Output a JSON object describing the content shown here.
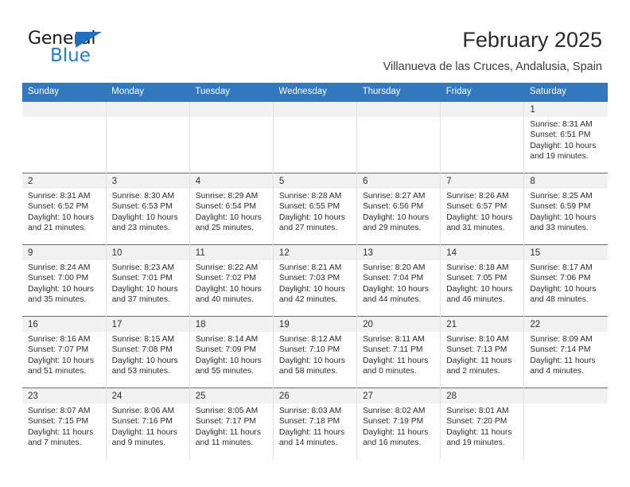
{
  "brand": {
    "name_part1": "General",
    "name_part2": "Blue",
    "triangle_color": "#1f6fc4",
    "blue_color": "#1f7fd0"
  },
  "header": {
    "title": "February 2025",
    "subtitle": "Villanueva de las Cruces, Andalusia, Spain"
  },
  "theme": {
    "header_blue": "#3178be",
    "band_gray": "#f1f1f1",
    "grid_line": "#e2e2e2"
  },
  "weekdays": [
    "Sunday",
    "Monday",
    "Tuesday",
    "Wednesday",
    "Thursday",
    "Friday",
    "Saturday"
  ],
  "labels": {
    "sunrise": "Sunrise:",
    "sunset": "Sunset:",
    "daylight": "Daylight:"
  },
  "weeks": [
    [
      {
        "day": "",
        "sunrise": "",
        "sunset": "",
        "daylight_line1": "",
        "daylight_line2": "",
        "empty": true
      },
      {
        "day": "",
        "sunrise": "",
        "sunset": "",
        "daylight_line1": "",
        "daylight_line2": "",
        "empty": true
      },
      {
        "day": "",
        "sunrise": "",
        "sunset": "",
        "daylight_line1": "",
        "daylight_line2": "",
        "empty": true
      },
      {
        "day": "",
        "sunrise": "",
        "sunset": "",
        "daylight_line1": "",
        "daylight_line2": "",
        "empty": true
      },
      {
        "day": "",
        "sunrise": "",
        "sunset": "",
        "daylight_line1": "",
        "daylight_line2": "",
        "empty": true
      },
      {
        "day": "",
        "sunrise": "",
        "sunset": "",
        "daylight_line1": "",
        "daylight_line2": "",
        "empty": true
      },
      {
        "day": "1",
        "sunrise": "Sunrise: 8:31 AM",
        "sunset": "Sunset: 6:51 PM",
        "daylight_line1": "Daylight: 10 hours",
        "daylight_line2": "and 19 minutes.",
        "empty": false
      }
    ],
    [
      {
        "day": "2",
        "sunrise": "Sunrise: 8:31 AM",
        "sunset": "Sunset: 6:52 PM",
        "daylight_line1": "Daylight: 10 hours",
        "daylight_line2": "and 21 minutes.",
        "empty": false
      },
      {
        "day": "3",
        "sunrise": "Sunrise: 8:30 AM",
        "sunset": "Sunset: 6:53 PM",
        "daylight_line1": "Daylight: 10 hours",
        "daylight_line2": "and 23 minutes.",
        "empty": false
      },
      {
        "day": "4",
        "sunrise": "Sunrise: 8:29 AM",
        "sunset": "Sunset: 6:54 PM",
        "daylight_line1": "Daylight: 10 hours",
        "daylight_line2": "and 25 minutes.",
        "empty": false
      },
      {
        "day": "5",
        "sunrise": "Sunrise: 8:28 AM",
        "sunset": "Sunset: 6:55 PM",
        "daylight_line1": "Daylight: 10 hours",
        "daylight_line2": "and 27 minutes.",
        "empty": false
      },
      {
        "day": "6",
        "sunrise": "Sunrise: 8:27 AM",
        "sunset": "Sunset: 6:56 PM",
        "daylight_line1": "Daylight: 10 hours",
        "daylight_line2": "and 29 minutes.",
        "empty": false
      },
      {
        "day": "7",
        "sunrise": "Sunrise: 8:26 AM",
        "sunset": "Sunset: 6:57 PM",
        "daylight_line1": "Daylight: 10 hours",
        "daylight_line2": "and 31 minutes.",
        "empty": false
      },
      {
        "day": "8",
        "sunrise": "Sunrise: 8:25 AM",
        "sunset": "Sunset: 6:59 PM",
        "daylight_line1": "Daylight: 10 hours",
        "daylight_line2": "and 33 minutes.",
        "empty": false
      }
    ],
    [
      {
        "day": "9",
        "sunrise": "Sunrise: 8:24 AM",
        "sunset": "Sunset: 7:00 PM",
        "daylight_line1": "Daylight: 10 hours",
        "daylight_line2": "and 35 minutes.",
        "empty": false
      },
      {
        "day": "10",
        "sunrise": "Sunrise: 8:23 AM",
        "sunset": "Sunset: 7:01 PM",
        "daylight_line1": "Daylight: 10 hours",
        "daylight_line2": "and 37 minutes.",
        "empty": false
      },
      {
        "day": "11",
        "sunrise": "Sunrise: 8:22 AM",
        "sunset": "Sunset: 7:02 PM",
        "daylight_line1": "Daylight: 10 hours",
        "daylight_line2": "and 40 minutes.",
        "empty": false
      },
      {
        "day": "12",
        "sunrise": "Sunrise: 8:21 AM",
        "sunset": "Sunset: 7:03 PM",
        "daylight_line1": "Daylight: 10 hours",
        "daylight_line2": "and 42 minutes.",
        "empty": false
      },
      {
        "day": "13",
        "sunrise": "Sunrise: 8:20 AM",
        "sunset": "Sunset: 7:04 PM",
        "daylight_line1": "Daylight: 10 hours",
        "daylight_line2": "and 44 minutes.",
        "empty": false
      },
      {
        "day": "14",
        "sunrise": "Sunrise: 8:18 AM",
        "sunset": "Sunset: 7:05 PM",
        "daylight_line1": "Daylight: 10 hours",
        "daylight_line2": "and 46 minutes.",
        "empty": false
      },
      {
        "day": "15",
        "sunrise": "Sunrise: 8:17 AM",
        "sunset": "Sunset: 7:06 PM",
        "daylight_line1": "Daylight: 10 hours",
        "daylight_line2": "and 48 minutes.",
        "empty": false
      }
    ],
    [
      {
        "day": "16",
        "sunrise": "Sunrise: 8:16 AM",
        "sunset": "Sunset: 7:07 PM",
        "daylight_line1": "Daylight: 10 hours",
        "daylight_line2": "and 51 minutes.",
        "empty": false
      },
      {
        "day": "17",
        "sunrise": "Sunrise: 8:15 AM",
        "sunset": "Sunset: 7:08 PM",
        "daylight_line1": "Daylight: 10 hours",
        "daylight_line2": "and 53 minutes.",
        "empty": false
      },
      {
        "day": "18",
        "sunrise": "Sunrise: 8:14 AM",
        "sunset": "Sunset: 7:09 PM",
        "daylight_line1": "Daylight: 10 hours",
        "daylight_line2": "and 55 minutes.",
        "empty": false
      },
      {
        "day": "19",
        "sunrise": "Sunrise: 8:12 AM",
        "sunset": "Sunset: 7:10 PM",
        "daylight_line1": "Daylight: 10 hours",
        "daylight_line2": "and 58 minutes.",
        "empty": false
      },
      {
        "day": "20",
        "sunrise": "Sunrise: 8:11 AM",
        "sunset": "Sunset: 7:11 PM",
        "daylight_line1": "Daylight: 11 hours",
        "daylight_line2": "and 0 minutes.",
        "empty": false
      },
      {
        "day": "21",
        "sunrise": "Sunrise: 8:10 AM",
        "sunset": "Sunset: 7:13 PM",
        "daylight_line1": "Daylight: 11 hours",
        "daylight_line2": "and 2 minutes.",
        "empty": false
      },
      {
        "day": "22",
        "sunrise": "Sunrise: 8:09 AM",
        "sunset": "Sunset: 7:14 PM",
        "daylight_line1": "Daylight: 11 hours",
        "daylight_line2": "and 4 minutes.",
        "empty": false
      }
    ],
    [
      {
        "day": "23",
        "sunrise": "Sunrise: 8:07 AM",
        "sunset": "Sunset: 7:15 PM",
        "daylight_line1": "Daylight: 11 hours",
        "daylight_line2": "and 7 minutes.",
        "empty": false
      },
      {
        "day": "24",
        "sunrise": "Sunrise: 8:06 AM",
        "sunset": "Sunset: 7:16 PM",
        "daylight_line1": "Daylight: 11 hours",
        "daylight_line2": "and 9 minutes.",
        "empty": false
      },
      {
        "day": "25",
        "sunrise": "Sunrise: 8:05 AM",
        "sunset": "Sunset: 7:17 PM",
        "daylight_line1": "Daylight: 11 hours",
        "daylight_line2": "and 11 minutes.",
        "empty": false
      },
      {
        "day": "26",
        "sunrise": "Sunrise: 8:03 AM",
        "sunset": "Sunset: 7:18 PM",
        "daylight_line1": "Daylight: 11 hours",
        "daylight_line2": "and 14 minutes.",
        "empty": false
      },
      {
        "day": "27",
        "sunrise": "Sunrise: 8:02 AM",
        "sunset": "Sunset: 7:19 PM",
        "daylight_line1": "Daylight: 11 hours",
        "daylight_line2": "and 16 minutes.",
        "empty": false
      },
      {
        "day": "28",
        "sunrise": "Sunrise: 8:01 AM",
        "sunset": "Sunset: 7:20 PM",
        "daylight_line1": "Daylight: 11 hours",
        "daylight_line2": "and 19 minutes.",
        "empty": false
      },
      {
        "day": "",
        "sunrise": "",
        "sunset": "",
        "daylight_line1": "",
        "daylight_line2": "",
        "empty": true
      }
    ]
  ]
}
